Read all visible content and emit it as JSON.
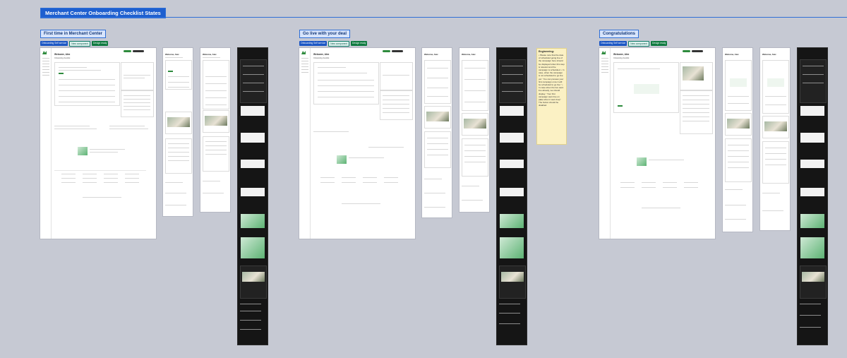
{
  "board": {
    "title": "Merchant Center Onboarding Checklist States"
  },
  "sections": [
    {
      "title": "First time in Merchant Center",
      "badges": [
        "Onboarding Self service",
        "New component",
        "Design ready"
      ]
    },
    {
      "title": "Go live with your deal",
      "badges": [
        "Onboarding Self service",
        "New component",
        "Design ready"
      ]
    },
    {
      "title": "Congratulations",
      "badges": [
        "Onboarding Self service",
        "New component",
        "Design ready"
      ]
    }
  ],
  "screens": {
    "welcome": "Welcome, Alex",
    "checklist": "Onboarding checklist"
  },
  "note": {
    "title": "Engineering:",
    "body": "• Please note that the date of scheduled going live of the campaign here should be displayed when this step is relevant and the campaign is scheduled. • In case, when the campaign is not scheduled to go live yet: “You can preview your first campaign once it will be scheduled to go live.” • In case when the live went live already, we should display: “Your first campaign went live on [date when it went live]” The button should be disabled."
  },
  "colors": {
    "accent_blue": "#1e5fcf",
    "brand_green": "#2e8b3d",
    "note_yellow": "#fbf1c4",
    "canvas": "#c6c9d3"
  }
}
